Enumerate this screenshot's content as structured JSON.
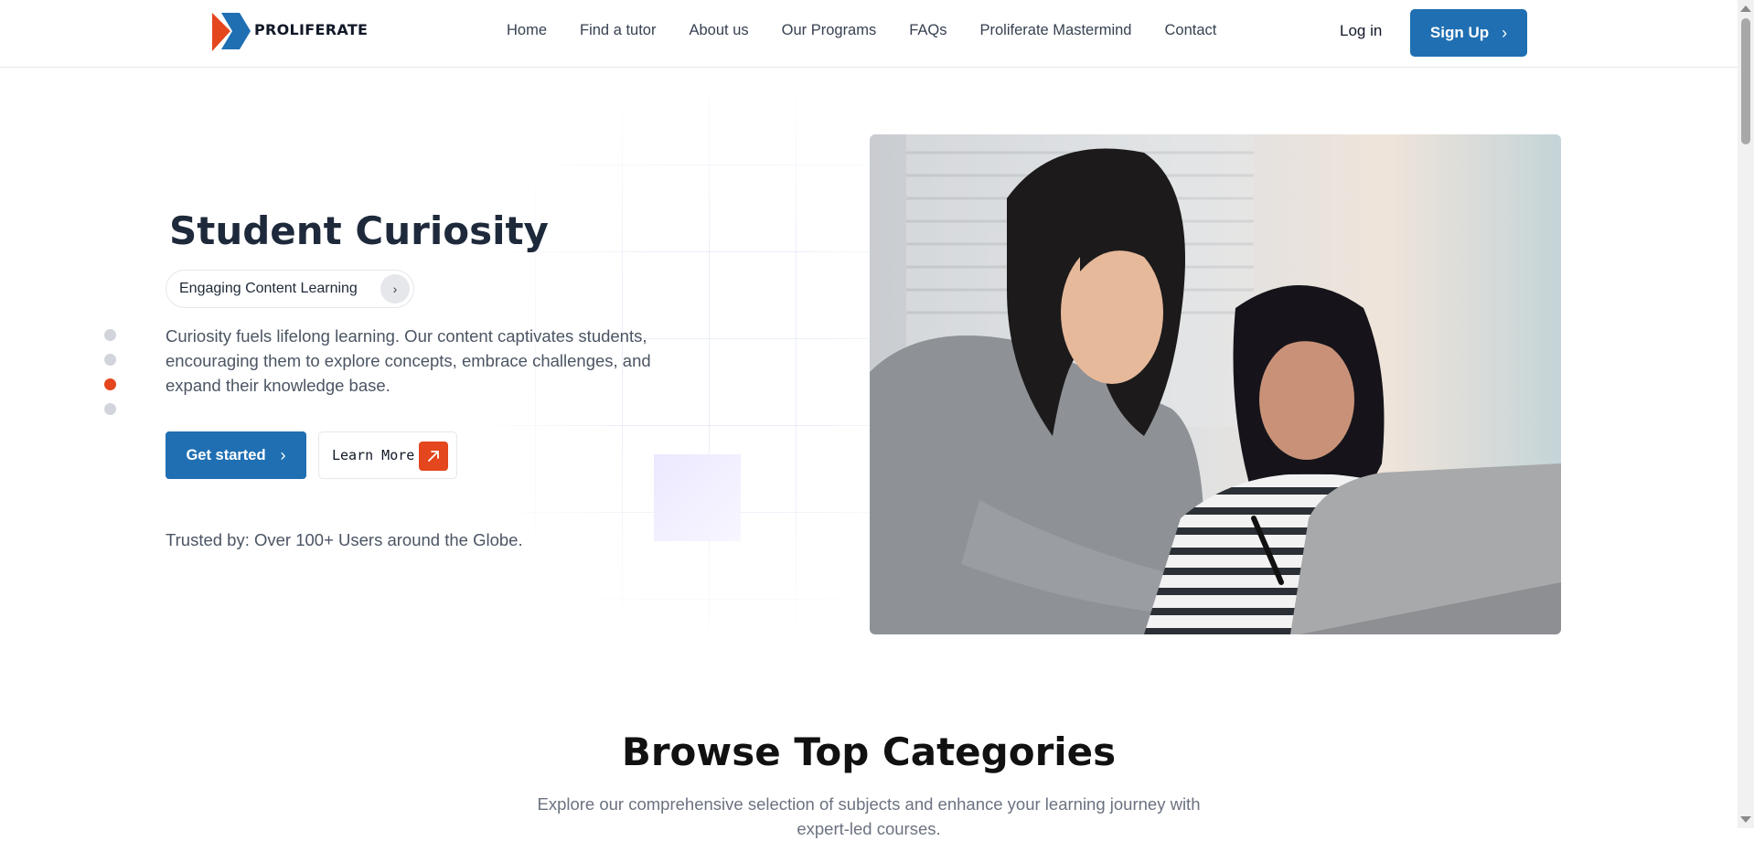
{
  "brand": {
    "name": "PROLIFERATE",
    "colors": {
      "blue": "#1f6fb2",
      "orange": "#e4461e"
    }
  },
  "nav": {
    "items": [
      "Home",
      "Find a tutor",
      "About us",
      "Our Programs",
      "FAQs",
      "Proliferate Mastermind",
      "Contact"
    ],
    "login": "Log in",
    "signup": "Sign Up"
  },
  "hero": {
    "slides_total": 4,
    "active_slide": 3,
    "title": "Student Curiosity",
    "pill": "Engaging Content Learning",
    "description": "Curiosity fuels lifelong learning. Our content captivates students, encouraging them to explore concepts, embrace challenges, and expand their knowledge base.",
    "get_started": "Get started",
    "learn_more": "Learn More",
    "trusted": "Trusted by: Over 100+ Users around the Globe."
  },
  "categories": {
    "title": "Browse Top Categories",
    "description": "Explore our comprehensive selection of subjects and enhance your learning journey with expert-led courses."
  }
}
